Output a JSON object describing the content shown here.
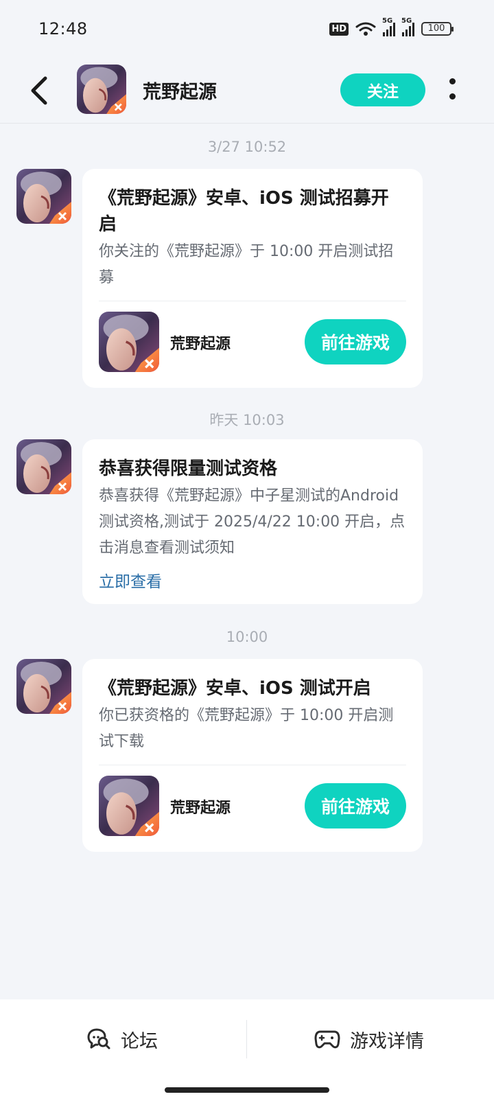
{
  "status_bar": {
    "time": "12:48",
    "hd_label": "HD",
    "network_label_1": "5G",
    "network_label_2": "5G",
    "battery_level": "100",
    "icons": [
      "hd-icon",
      "wifi-icon",
      "signal-icon",
      "signal-icon",
      "battery-icon"
    ]
  },
  "header": {
    "title": "荒野起源",
    "follow_label": "关注",
    "back_icon": "chevron-left-icon",
    "more_icon": "more-vertical-icon"
  },
  "messages": [
    {
      "time": "3/27  10:52",
      "title": "《荒野起源》安卓、iOS 测试招募开启",
      "body": "你关注的《荒野起源》于 10:00 开启测试招募",
      "game_name": "荒野起源",
      "action_label": "前往游戏"
    },
    {
      "time": "昨天  10:03",
      "title": "恭喜获得限量测试资格",
      "body": "恭喜获得《荒野起源》中子星测试的Android测试资格,测试于 2025/4/22 10:00 开启，点击消息查看测试须知",
      "link_label": "立即查看"
    },
    {
      "time": "10:00",
      "title": "《荒野起源》安卓、iOS 测试开启",
      "body": "你已获资格的《荒野起源》于 10:00 开启测试下载",
      "game_name": "荒野起源",
      "action_label": "前往游戏"
    }
  ],
  "bottom_bar": {
    "forum_label": "论坛",
    "forum_icon": "chat-search-icon",
    "detail_label": "游戏详情",
    "detail_icon": "gamepad-icon"
  },
  "colors": {
    "accent": "#0fd3c0",
    "background": "#f3f5f9",
    "link": "#2a6ea7"
  }
}
